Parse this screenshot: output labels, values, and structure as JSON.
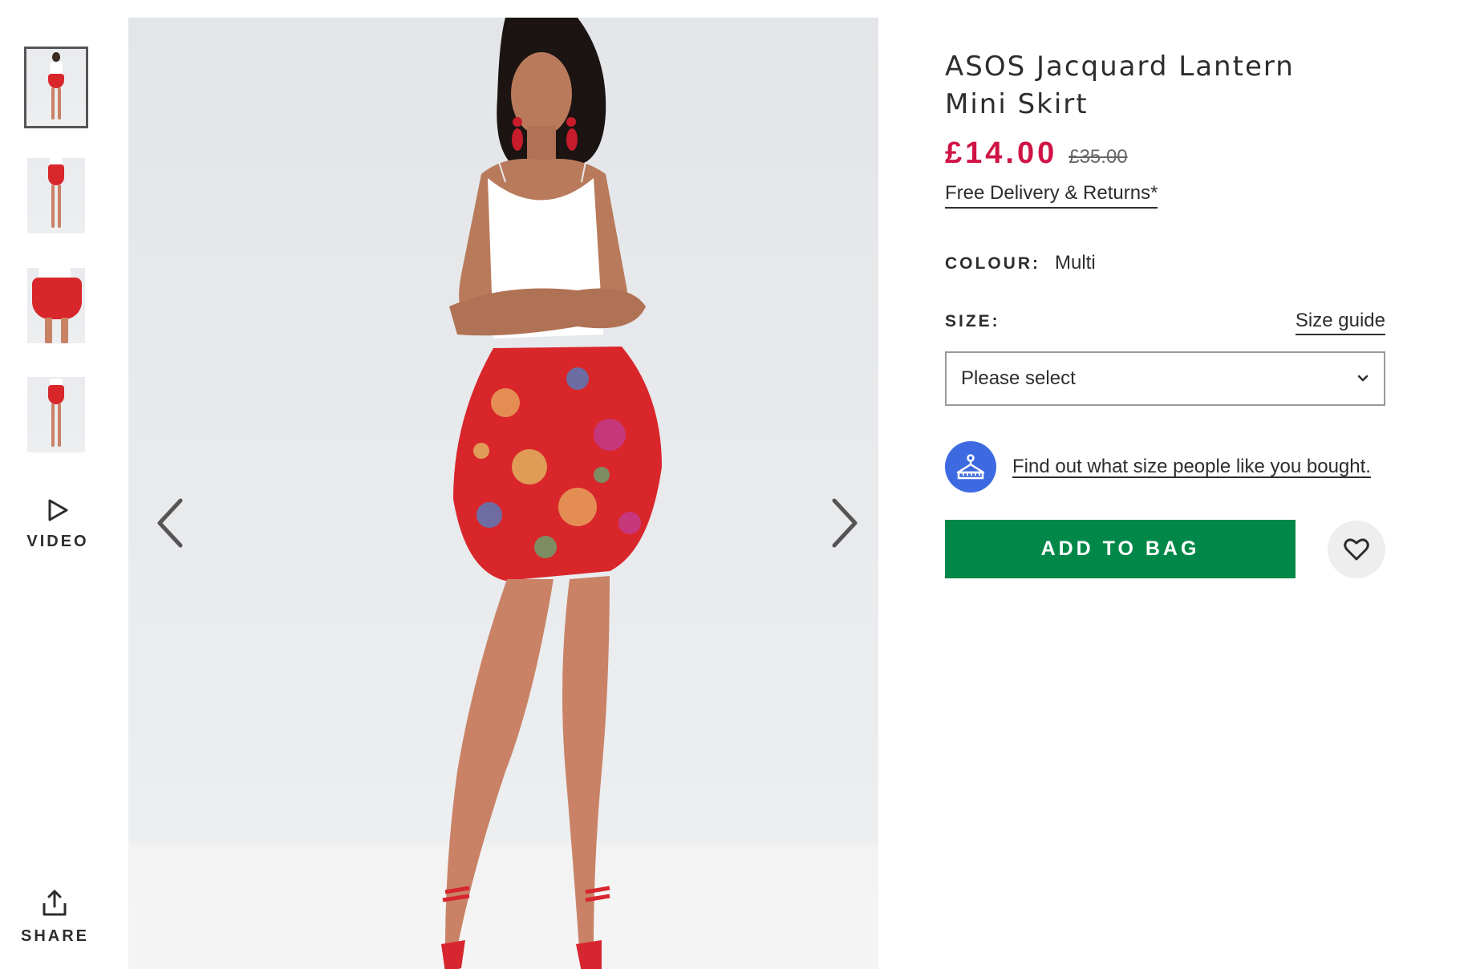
{
  "gallery": {
    "thumbnails": [
      {
        "label": "thumbnail-1"
      },
      {
        "label": "thumbnail-2"
      },
      {
        "label": "thumbnail-3"
      },
      {
        "label": "thumbnail-4"
      }
    ],
    "active_index": 0,
    "video_label": "VIDEO",
    "share_label": "SHARE",
    "prev_icon": "chevron-left-icon",
    "next_icon": "chevron-right-icon"
  },
  "product": {
    "title": "ASOS Jacquard Lantern Mini Skirt",
    "price_now": "£14.00",
    "price_was": "£35.00",
    "delivery_link": "Free Delivery & Returns*",
    "colour_label": "COLOUR:",
    "colour_value": "Multi",
    "size_label": "SIZE:",
    "size_guide": "Size guide",
    "size_select_value": "Please select",
    "fit_link": "Find out what size people like you bought.",
    "add_to_bag": "ADD TO BAG"
  },
  "colors": {
    "price_now": "#d01345",
    "add_to_bag_bg": "#018849",
    "fit_icon_bg": "#3d6ae0"
  }
}
